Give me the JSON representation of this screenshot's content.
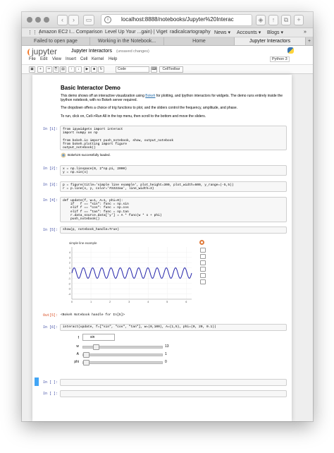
{
  "browser": {
    "url": "localhost:8888/notebooks/Jupyter%20Interac",
    "bookmarks": [
      "Amazon EC2 I... Comparison",
      "Level Up Your ...gain) | Viget",
      "radicalcartography",
      "News ▾",
      "Accounts ▾",
      "Blogs ▾"
    ],
    "tabs": [
      "Failed to open page",
      "Working in the Notebook...",
      "Home",
      "Jupyter Interactors"
    ],
    "active_tab_index": 3
  },
  "notebook": {
    "logo": "jupyter",
    "name": "Jupyter Interactors",
    "save_status": "(unsaved changes)",
    "menu": [
      "File",
      "Edit",
      "View",
      "Insert",
      "Cell",
      "Kernel",
      "Help"
    ],
    "kernel": "Python 3",
    "cell_type": "Code",
    "celltoolbar": "CellToolbar"
  },
  "content": {
    "title": "Basic Interactor Demo",
    "para1_a": "This demo shows off an interactive visualization using ",
    "para1_link": "Bokeh",
    "para1_b": " for plotting, and Ipython interactors for widgets. The demo runs entirely inside the Ipython notebook, with no Bokeh server required.",
    "para2": "The dropdown offers a choice of trig functions to plot, and the sliders control the frequency, amplitude, and phase.",
    "para3": "To run, click on, Cell->Run All in the top menu, then scroll to the bottom and move the sliders."
  },
  "cells": {
    "c1_prompt": "In [1]:",
    "c1_code": "from ipywidgets import interact\nimport numpy as np\n\nfrom bokeh.io import push_notebook, show, output_notebook\nfrom bokeh.plotting import figure\noutput_notebook()",
    "c1_out": "BokehJS successfully loaded.",
    "c2_prompt": "In [2]:",
    "c2_code": "x = np.linspace(0, 2*np.pi, 2000)\ny = np.sin(x)",
    "c3_prompt": "In [3]:",
    "c3_code": "p = figure(title='simple line example', plot_height=300, plot_width=600, y_range=(-5,5))\nr = p.line(x, y, color='#2222aa', line_width=3)",
    "c4_prompt": "In [4]:",
    "c4_code": "def update(f, w=1, A=1, phi=0):\n    if   f == \"sin\": func = np.sin\n    elif f == \"cos\": func = np.cos\n    elif f == \"tan\": func = np.tan\n    r.data_source.data['y'] = A * func(w * x + phi)\n    push_notebook()",
    "c5_prompt": "In [5]:",
    "c5_code": "show(p, notebook_handle=True)",
    "c5_outprompt": "Out[5]:",
    "c5_out": "<Bokeh Notebook handle for In[5]>",
    "c6_prompt": "In [6]:",
    "c6_code": "interact(update, f=[\"sin\", \"cos\", \"tan\"], w=(0,100), A=(1,5), phi=(0, 20, 0.1))",
    "c7_prompt": "In [ ]:",
    "c8_prompt": "In [ ]:"
  },
  "widgets": {
    "f_label": "f",
    "f_value": "sin",
    "w_label": "w",
    "w_value": "13",
    "A_label": "A",
    "A_value": "1",
    "phi_label": "phi",
    "phi_value": "0",
    "w_fraction": 0.13,
    "A_fraction": 0.0,
    "phi_fraction": 0.0
  },
  "chart_data": {
    "type": "line",
    "title": "simple line example",
    "xlim": [
      0,
      6.283
    ],
    "ylim": [
      -5,
      5
    ],
    "x_ticks": [
      "0",
      "1",
      "2",
      "3",
      "4",
      "5",
      "6"
    ],
    "y_ticks": [
      "4",
      "3",
      "2",
      "1",
      "0",
      "-1",
      "-2",
      "-3",
      "-4"
    ],
    "function": "sin",
    "w": 13,
    "A": 1,
    "phi": 0,
    "color": "#2222aa"
  }
}
